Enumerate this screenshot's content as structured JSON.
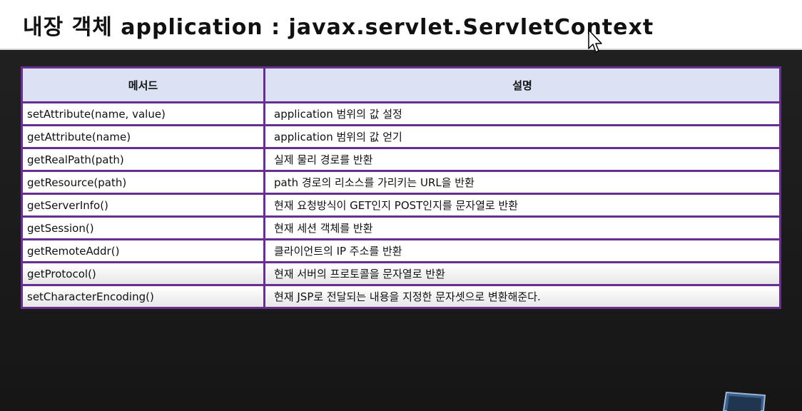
{
  "slide": {
    "title": "내장 객체 application : javax.servlet.ServletContext"
  },
  "table": {
    "headers": [
      "메서드",
      "설명"
    ],
    "rows": [
      {
        "method": "setAttribute(name, value)",
        "description": "application 범위의 값 설정"
      },
      {
        "method": "getAttribute(name)",
        "description": "application 범위의 값 얻기"
      },
      {
        "method": "getRealPath(path)",
        "description": "실제 물리 경로를 반환"
      },
      {
        "method": "getResource(path)",
        "description": "path 경로의 리소스를 가리키는 URL을 반환"
      },
      {
        "method": "getServerInfo()",
        "description": "현재 요청방식이 GET인지 POST인지를 문자열로 반환"
      },
      {
        "method": "getSession()",
        "description": "현재 세션 객체를 반환"
      },
      {
        "method": "getRemoteAddr()",
        "description": "클라이언트의 IP 주소를 반환"
      },
      {
        "method": "getProtocol()",
        "description": "현재 서버의 프로토콜을 문자열로 반환"
      },
      {
        "method": "setCharacterEncoding()",
        "description": "현재 JSP로 전달되는 내용을 지정한 문자셋으로 변환해준다."
      }
    ]
  },
  "colors": {
    "border": "#6a2d91",
    "header_fill": "#dae2f3",
    "background": "#1c1c1c"
  },
  "icons": {
    "cursor": "mouse-pointer-icon"
  }
}
